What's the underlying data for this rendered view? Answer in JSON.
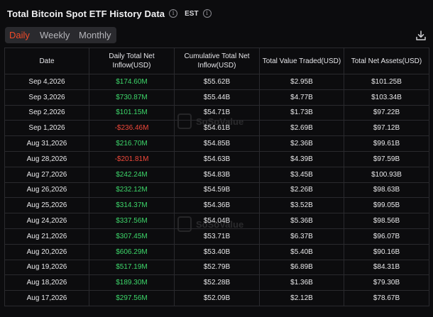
{
  "header": {
    "title": "Total Bitcoin Spot ETF History Data",
    "info_glyph": "i",
    "timezone": "EST",
    "tz_info_glyph": "i"
  },
  "tabs": [
    {
      "label": "Daily",
      "active": true
    },
    {
      "label": "Weekly",
      "active": false
    },
    {
      "label": "Monthly",
      "active": false
    }
  ],
  "toolbar": {
    "download_icon": "download-icon"
  },
  "watermark": {
    "text": "SoSoValue"
  },
  "colors": {
    "accent": "#f24a28",
    "positive": "#3dd66a",
    "negative": "#f0483a",
    "background": "#0c0c0e"
  },
  "table": {
    "columns": [
      "Date",
      "Daily Total Net Inflow(USD)",
      "Cumulative Total Net Inflow(USD)",
      "Total Value Traded(USD)",
      "Total Net Assets(USD)"
    ],
    "rows": [
      {
        "date": "Sep 4,2026",
        "daily": "$174.60M",
        "sign": "pos",
        "cumulative": "$55.62B",
        "traded": "$2.95B",
        "assets": "$101.25B"
      },
      {
        "date": "Sep 3,2026",
        "daily": "$730.87M",
        "sign": "pos",
        "cumulative": "$55.44B",
        "traded": "$4.77B",
        "assets": "$103.34B"
      },
      {
        "date": "Sep 2,2026",
        "daily": "$101.15M",
        "sign": "pos",
        "cumulative": "$54.71B",
        "traded": "$1.73B",
        "assets": "$97.22B"
      },
      {
        "date": "Sep 1,2026",
        "daily": "-$236.46M",
        "sign": "neg",
        "cumulative": "$54.61B",
        "traded": "$2.69B",
        "assets": "$97.12B"
      },
      {
        "date": "Aug 31,2026",
        "daily": "$216.70M",
        "sign": "pos",
        "cumulative": "$54.85B",
        "traded": "$2.36B",
        "assets": "$99.61B"
      },
      {
        "date": "Aug 28,2026",
        "daily": "-$201.81M",
        "sign": "neg",
        "cumulative": "$54.63B",
        "traded": "$4.39B",
        "assets": "$97.59B"
      },
      {
        "date": "Aug 27,2026",
        "daily": "$242.24M",
        "sign": "pos",
        "cumulative": "$54.83B",
        "traded": "$3.45B",
        "assets": "$100.93B"
      },
      {
        "date": "Aug 26,2026",
        "daily": "$232.12M",
        "sign": "pos",
        "cumulative": "$54.59B",
        "traded": "$2.26B",
        "assets": "$98.63B"
      },
      {
        "date": "Aug 25,2026",
        "daily": "$314.37M",
        "sign": "pos",
        "cumulative": "$54.36B",
        "traded": "$3.52B",
        "assets": "$99.05B"
      },
      {
        "date": "Aug 24,2026",
        "daily": "$337.56M",
        "sign": "pos",
        "cumulative": "$54.04B",
        "traded": "$5.36B",
        "assets": "$98.56B"
      },
      {
        "date": "Aug 21,2026",
        "daily": "$307.45M",
        "sign": "pos",
        "cumulative": "$53.71B",
        "traded": "$6.37B",
        "assets": "$96.07B"
      },
      {
        "date": "Aug 20,2026",
        "daily": "$606.29M",
        "sign": "pos",
        "cumulative": "$53.40B",
        "traded": "$5.40B",
        "assets": "$90.16B"
      },
      {
        "date": "Aug 19,2026",
        "daily": "$517.19M",
        "sign": "pos",
        "cumulative": "$52.79B",
        "traded": "$6.89B",
        "assets": "$84.31B"
      },
      {
        "date": "Aug 18,2026",
        "daily": "$189.30M",
        "sign": "pos",
        "cumulative": "$52.28B",
        "traded": "$1.36B",
        "assets": "$79.30B"
      },
      {
        "date": "Aug 17,2026",
        "daily": "$297.56M",
        "sign": "pos",
        "cumulative": "$52.09B",
        "traded": "$2.12B",
        "assets": "$78.67B"
      }
    ]
  }
}
